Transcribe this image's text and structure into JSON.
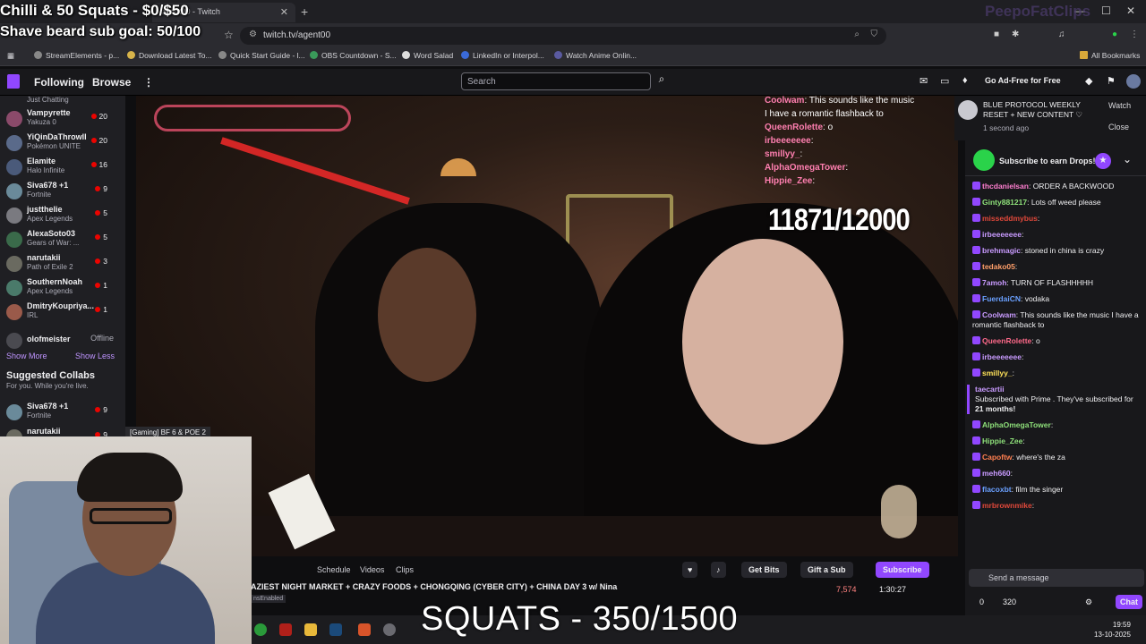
{
  "browser": {
    "tab_title": "agent00 - Twitch",
    "url": "twitch.tv/agent00",
    "bookmarks": [
      "StreamElements - p...",
      "Download Latest To...",
      "Quick Start Guide - l...",
      "OBS Countdown - S...",
      "Word Salad",
      "LinkedIn or Interpol...",
      "Watch Anime Onlin...",
      "All Bookmarks"
    ]
  },
  "twitch_nav": {
    "following": "Following",
    "browse": "Browse",
    "search_placeholder": "Search",
    "ad_free": "Go Ad-Free for Free"
  },
  "sidebar": {
    "top_subtitle": "Just Chatting",
    "channels": [
      {
        "name": "Vampyrette",
        "game": "Yakuza 0",
        "viewers": "20",
        "color": "#8a4a6a"
      },
      {
        "name": "YiQinDaThrowll",
        "game": "Pokémon UNITE",
        "viewers": "20",
        "color": "#5a6a8a"
      },
      {
        "name": "Elamite",
        "game": "Halo Infinite",
        "viewers": "16",
        "color": "#4a5a7a"
      },
      {
        "name": "Siva678 +1",
        "game": "Fortnite",
        "viewers": "9",
        "color": "#6a8a9a"
      },
      {
        "name": "justthelie",
        "game": "Apex Legends",
        "viewers": "5",
        "color": "#7a7a80"
      },
      {
        "name": "AlexaSoto03",
        "game": "Gears of War: ...",
        "viewers": "5",
        "color": "#3a6a4a"
      },
      {
        "name": "narutakii",
        "game": "Path of Exile 2",
        "viewers": "3",
        "color": "#6a6a60"
      },
      {
        "name": "SouthernNoah",
        "game": "Apex Legends",
        "viewers": "1",
        "color": "#4a7a6a"
      },
      {
        "name": "DmitryKoupriya...",
        "game": "IRL",
        "viewers": "1",
        "color": "#9a5a4a"
      }
    ],
    "offline_channel": {
      "name": "olofmeister",
      "status": "Offline"
    },
    "show_more": "Show More",
    "show_less": "Show Less",
    "suggested_title": "Suggested Collabs",
    "suggested_sub": "For you. While you're live.",
    "suggested": [
      {
        "name": "Siva678 +1",
        "game": "Fortnite",
        "viewers": "9"
      },
      {
        "name": "narutakii",
        "game": "",
        "viewers": "9"
      }
    ]
  },
  "video": {
    "counter": "11871/12000",
    "chat_overlay": [
      {
        "user": "Coolwam",
        "text": ": This sounds like the music"
      },
      {
        "user": "",
        "text": "I have a romantic flashback to"
      },
      {
        "user": "QueenRolette",
        "text": ": o"
      },
      {
        "user": "irbeeeeeee",
        "text": ":"
      },
      {
        "user": "smillyy_",
        "text": ":"
      },
      {
        "user": "AlphaOmegaTower",
        "text": ":"
      },
      {
        "user": "Hippie_Zee",
        "text": ":"
      }
    ]
  },
  "notification": {
    "title": "BLUE PROTOCOL WEEKLY RESET + NEW CONTENT ♡",
    "time": "1 second ago",
    "watch": "Watch",
    "close": "Close"
  },
  "chat": {
    "drops_text": "Subscribe to earn Drops!",
    "messages": [
      {
        "user": "thcdanielsan",
        "text": ": ORDER A BACKWOOD",
        "color": "#ff7fd0"
      },
      {
        "user": "Ginty881217",
        "text": ": Lots off weed please",
        "color": "#8ee07a"
      },
      {
        "user": "misseddmybus",
        "text": ":",
        "color": "#e0483a"
      },
      {
        "user": "irbeeeeeee",
        "text": ":",
        "color": "#c99bff"
      },
      {
        "user": "brehmagic",
        "text": ": stoned in china is crazy",
        "color": "#c99bff"
      },
      {
        "user": "tedako05",
        "text": ":",
        "color": "#ff9f6a"
      },
      {
        "user": "7amoh",
        "text": ": TURN OF FLASHHHHH",
        "color": "#c99bff"
      },
      {
        "user": "FuerdaiCN",
        "text": ": vodaka",
        "color": "#6aa0ff"
      },
      {
        "user": "Coolwam",
        "text": ": This sounds like the music I have a romantic flashback to",
        "color": "#c99bff"
      },
      {
        "user": "QueenRolette",
        "text": ": o",
        "color": "#ff6a8a"
      },
      {
        "user": "irbeeeeeee",
        "text": ":",
        "color": "#c99bff"
      },
      {
        "user": "smillyy_",
        "text": ":",
        "color": "#ffe25a"
      }
    ],
    "sub_alert": {
      "user": "taecartii",
      "line1": "Subscribed with Prime . They've subscribed for",
      "months": "21 months!"
    },
    "messages_after": [
      {
        "user": "AlphaOmegaTower",
        "text": ":",
        "color": "#8ee07a"
      },
      {
        "user": "Hippie_Zee",
        "text": ":",
        "color": "#8ee07a"
      },
      {
        "user": "Capoftw",
        "text": ": where's the za",
        "color": "#ff7f50"
      },
      {
        "user": "meh660",
        "text": ":",
        "color": "#c99bff"
      },
      {
        "user": "flacoxbt",
        "text": ": film the singer",
        "color": "#6aa0ff"
      },
      {
        "user": "mrbrownmike",
        "text": ":",
        "color": "#e0483a"
      }
    ],
    "send_placeholder": "Send a message",
    "points_a": "0",
    "points_b": "320",
    "chat_button": "Chat"
  },
  "stream_info": {
    "tabs": [
      "Schedule",
      "Videos",
      "Clips"
    ],
    "get_bits": "Get Bits",
    "gift_sub": "Gift a Sub",
    "subscribe": "Subscribe",
    "title": "AZIEST NIGHT MARKET + CRAZY FOODS + CHONGQING (CYBER CITY) + CHINA DAY 3 w/ Nina",
    "tag": "nsEnabled",
    "viewers": "7,574",
    "uptime": "1:30:27"
  },
  "overlay": {
    "line1": "Chilli & 50 Squats - $0/$50",
    "line2": "Shave beard sub goal: 50/100",
    "squats": "SQUATS - 350/1500",
    "brand": "PeepoFatClips",
    "cam_label": "[Gaming] BF 6 & POE 2"
  },
  "taskbar": {
    "time": "19:59",
    "date": "13-10-2025"
  }
}
